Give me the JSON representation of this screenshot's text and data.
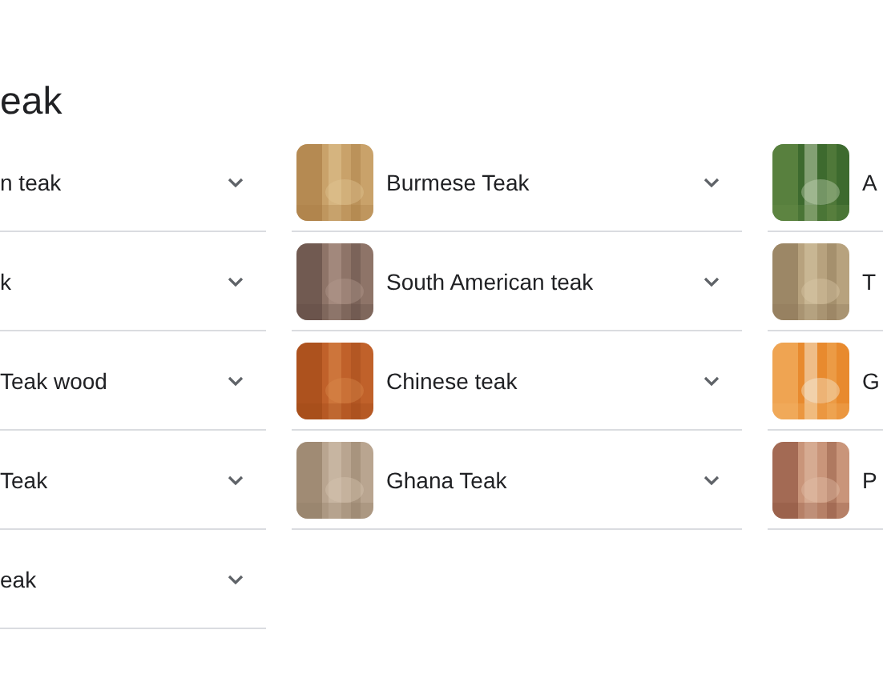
{
  "title": "eak",
  "columns": [
    {
      "items": [
        {
          "label": "n teak",
          "kind": "text",
          "expanded": false
        },
        {
          "label": "k",
          "kind": "text",
          "expanded": false
        },
        {
          "label": "Teak wood",
          "kind": "text",
          "expanded": false
        },
        {
          "label": "Teak",
          "kind": "text",
          "expanded": false
        },
        {
          "label": "eak",
          "kind": "text",
          "expanded": false
        }
      ]
    },
    {
      "items": [
        {
          "label": "Burmese Teak",
          "kind": "picture",
          "expanded": false
        },
        {
          "label": "South American teak",
          "kind": "picture",
          "expanded": false
        },
        {
          "label": "Chinese teak",
          "kind": "picture",
          "expanded": false
        },
        {
          "label": "Ghana Teak",
          "kind": "picture",
          "expanded": false
        }
      ]
    },
    {
      "items": [
        {
          "label": "A",
          "kind": "picture"
        },
        {
          "label": "T",
          "kind": "picture"
        },
        {
          "label": "G",
          "kind": "picture"
        },
        {
          "label": "P",
          "kind": "picture"
        }
      ]
    }
  ]
}
